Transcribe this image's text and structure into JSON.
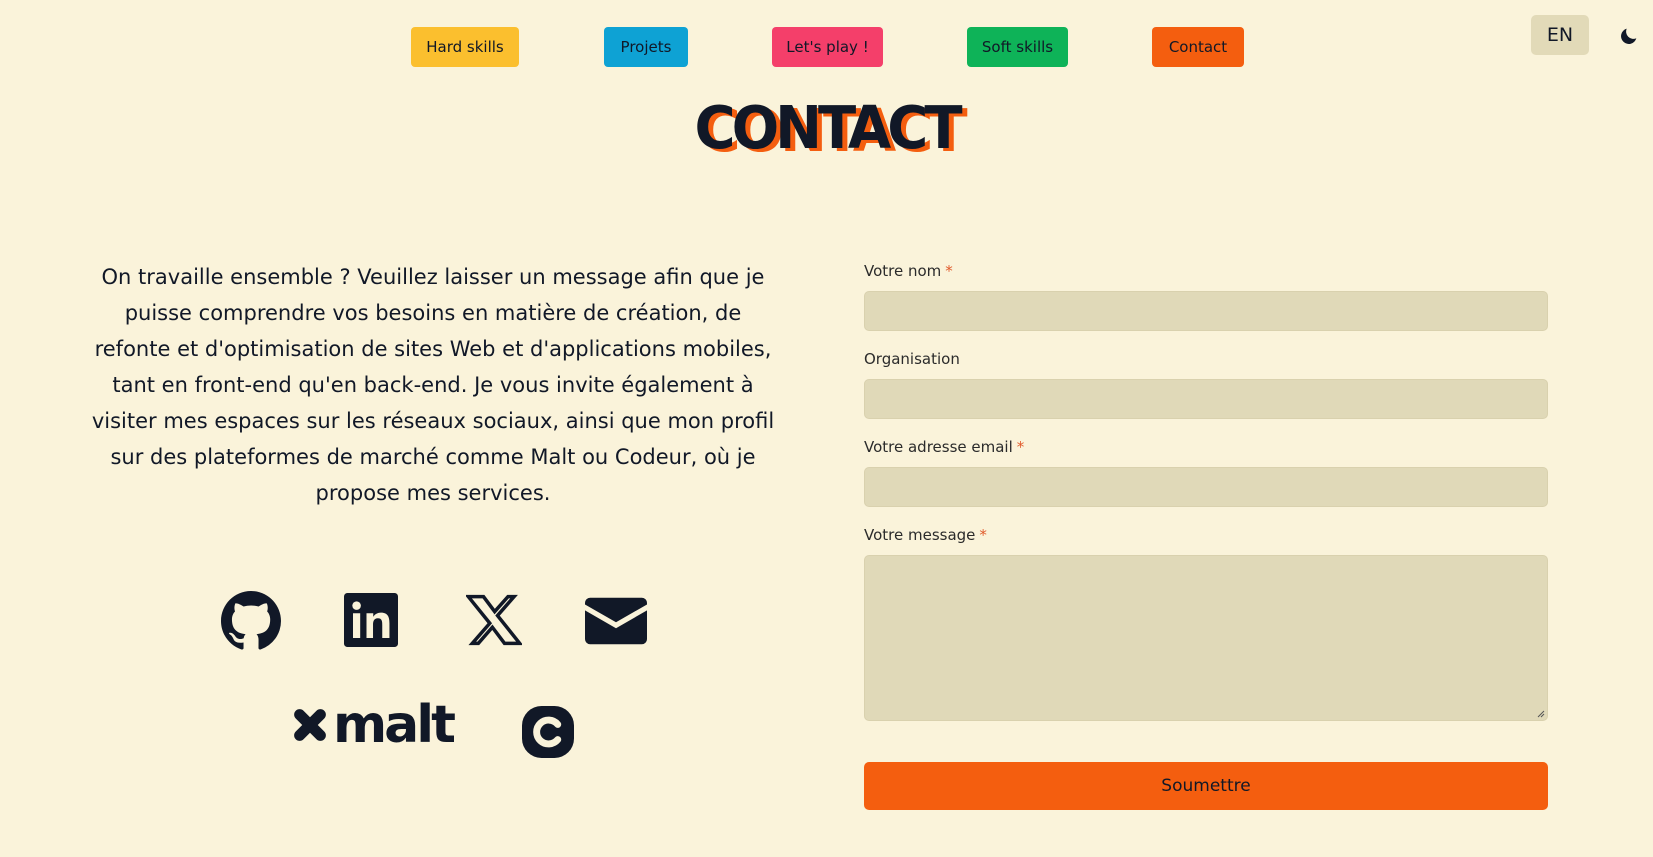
{
  "nav": {
    "items": [
      {
        "label": "Hard skills",
        "color": "#fbbf2e"
      },
      {
        "label": "Projets",
        "color": "#0ea2d4"
      },
      {
        "label": "Let's play !",
        "color": "#f43f6a"
      },
      {
        "label": "Soft skills",
        "color": "#0eb358"
      },
      {
        "label": "Contact",
        "color": "#f45e0f"
      }
    ]
  },
  "header": {
    "lang_label": "EN",
    "theme_icon": "moon-icon"
  },
  "page_title": "CONTACT",
  "intro_text": "On travaille ensemble ? Veuillez laisser un message afin que je puisse comprendre vos besoins en matière de création, de refonte et d'optimisation de sites Web et d'applications mobiles, tant en front-end qu'en back-end. Je vous invite également à visiter mes espaces sur les réseaux sociaux, ainsi que mon profil sur des plateformes de marché comme Malt ou Codeur, où je propose mes services.",
  "social": {
    "icons": [
      "github-icon",
      "linkedin-icon",
      "x-icon",
      "email-icon",
      "malt-logo",
      "codeur-icon"
    ],
    "malt_text": "malt"
  },
  "form": {
    "name_label": "Votre nom",
    "org_label": "Organisation",
    "email_label": "Votre adresse email",
    "message_label": "Votre message",
    "required_mark": "*",
    "submit_label": "Soumettre",
    "name_value": "",
    "org_value": "",
    "email_value": "",
    "message_value": ""
  },
  "colors": {
    "background": "#faf3da",
    "accent": "#f45e0f",
    "text": "#111827",
    "input_bg": "#e0d9b8"
  }
}
